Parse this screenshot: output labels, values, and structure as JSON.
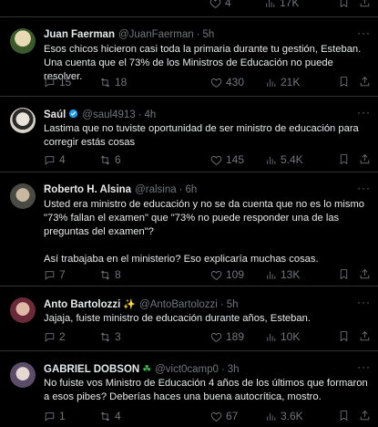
{
  "top_actions": {
    "likes": "4",
    "views": "17K"
  },
  "tweets": [
    {
      "name": "Juan Faerman",
      "handle": "@JuanFaerman",
      "time": "5h",
      "text": "Esos chicos hicieron casi toda la primaria durante tu gestión, Esteban. Una cuenta que el 73% de los Ministros de Educación no puede resolver.",
      "replies": "15",
      "retweets": "18",
      "likes": "430",
      "views": "21K",
      "avatar_color": "#c9c09a"
    },
    {
      "name": "Saúl",
      "handle": "@saul4913",
      "time": "4h",
      "text": "Lastima que no tuviste oportunidad de ser ministro de educación para corregir estás cosas",
      "replies": "4",
      "retweets": "6",
      "likes": "145",
      "views": "5.4K",
      "avatar_color": "#d9d2c8"
    },
    {
      "name": "Roberto H. Alsina",
      "handle": "@ralsina",
      "time": "6h",
      "text": "Usted era ministro de educación y no se da cuenta que no es lo mismo \"73% fallan el examen\" que \"73% no puede responder una de las preguntas del examen\"?\n\nAsí trabajaba en el ministerio? Eso explicaría muchas cosas.",
      "replies": "7",
      "retweets": "8",
      "likes": "109",
      "views": "13K",
      "avatar_color": "#6f6a60"
    },
    {
      "name": "Anto Bartolozzi",
      "handle": "@AntoBartolozzi",
      "time": "5h",
      "text": "Jajaja, fuiste ministro de educación durante años, Esteban.",
      "replies": "2",
      "retweets": "3",
      "likes": "189",
      "views": "10K",
      "avatar_color": "#a4506a"
    },
    {
      "name": "GABRIEL DOBSON",
      "handle": "@vict0camp0",
      "time": "3h",
      "text": "No fuiste vos Ministro de Educación 4 años de los últimos que formaron a esos pibes? Deberías haces una buena autocrítica, mostro.",
      "replies": "1",
      "retweets": "4",
      "likes": "67",
      "views": "3.6K",
      "avatar_color": "#b7b0c0"
    }
  ],
  "more_label": "···"
}
